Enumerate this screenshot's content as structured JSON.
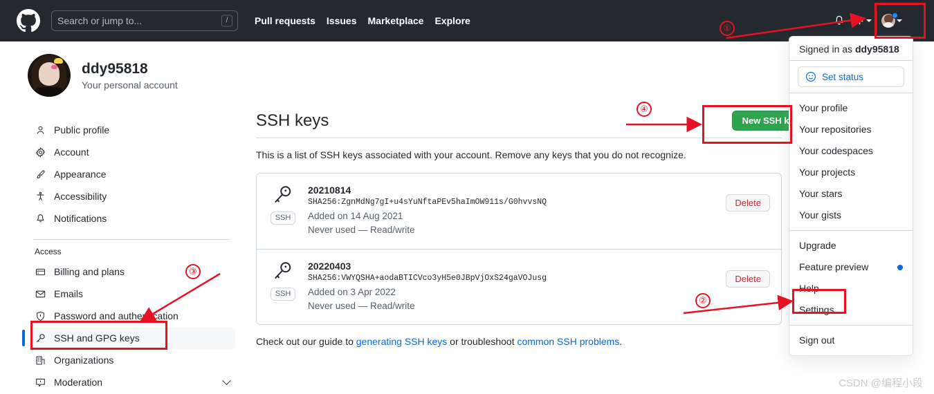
{
  "header": {
    "logo_icon": "github-logo-icon",
    "search_placeholder": "Search or jump to...",
    "search_shortcut": "/",
    "nav": [
      {
        "label": "Pull requests"
      },
      {
        "label": "Issues"
      },
      {
        "label": "Marketplace"
      },
      {
        "label": "Explore"
      }
    ],
    "icons": {
      "notifications": "bell-icon",
      "create_new": "plus-icon",
      "account_menu": "avatar-icon"
    }
  },
  "sidebar": {
    "username": "ddy95818",
    "account_subtitle": "Your personal account",
    "items": [
      {
        "label": "Public profile",
        "icon": "person-icon",
        "active": false
      },
      {
        "label": "Account",
        "icon": "gear-icon",
        "active": false
      },
      {
        "label": "Appearance",
        "icon": "paintbrush-icon",
        "active": false
      },
      {
        "label": "Accessibility",
        "icon": "accessibility-icon",
        "active": false
      },
      {
        "label": "Notifications",
        "icon": "bell-icon",
        "active": false
      }
    ],
    "access_heading": "Access",
    "access_items": [
      {
        "label": "Billing and plans",
        "icon": "credit-card-icon",
        "active": false
      },
      {
        "label": "Emails",
        "icon": "mail-icon",
        "active": false
      },
      {
        "label": "Password and authentication",
        "icon": "shield-lock-icon",
        "active": false
      },
      {
        "label": "SSH and GPG keys",
        "icon": "key-icon",
        "active": true
      },
      {
        "label": "Organizations",
        "icon": "organization-icon",
        "active": false
      },
      {
        "label": "Moderation",
        "icon": "report-icon",
        "active": false,
        "expandable": true
      }
    ]
  },
  "main": {
    "title": "SSH keys",
    "new_key_button": "New SSH key",
    "description": "This is a list of SSH keys associated with your account. Remove any keys that you do not recognize.",
    "keys": [
      {
        "name": "20210814",
        "fingerprint": "SHA256:ZgnMdNg7gI+u4sYuNftaPEv5haImOW911s/G0hvvsNQ",
        "added": "Added on 14 Aug 2021",
        "usage": "Never used — Read/write",
        "badge": "SSH",
        "delete_label": "Delete"
      },
      {
        "name": "20220403",
        "fingerprint": "SHA256:VWYQSHA+aodaBTICVco3yH5e0JBpVjOxS24gaVOJusg",
        "added": "Added on 3 Apr 2022",
        "usage": "Never used — Read/write",
        "badge": "SSH",
        "delete_label": "Delete"
      }
    ],
    "footnote": {
      "prefix": "Check out our guide to ",
      "link1": "generating SSH keys",
      "middle": " or troubleshoot ",
      "link2": "common SSH problems",
      "suffix": "."
    }
  },
  "user_menu": {
    "signed_in_prefix": "Signed in as ",
    "signed_in_user": "ddy95818",
    "set_status": "Set status",
    "set_status_icon": "smiley-icon",
    "group1": [
      {
        "label": "Your profile"
      },
      {
        "label": "Your repositories"
      },
      {
        "label": "Your codespaces"
      },
      {
        "label": "Your projects"
      },
      {
        "label": "Your stars"
      },
      {
        "label": "Your gists"
      }
    ],
    "group2": [
      {
        "label": "Upgrade",
        "dot": false
      },
      {
        "label": "Feature preview",
        "dot": true
      },
      {
        "label": "Help",
        "dot": false
      },
      {
        "label": "Settings",
        "dot": false
      }
    ],
    "group3": [
      {
        "label": "Sign out"
      }
    ]
  },
  "annotations": {
    "marker_1": "①",
    "marker_2": "②",
    "marker_3": "③",
    "marker_4": "④",
    "color": "#e81123"
  },
  "watermark": "CSDN @编程小段"
}
